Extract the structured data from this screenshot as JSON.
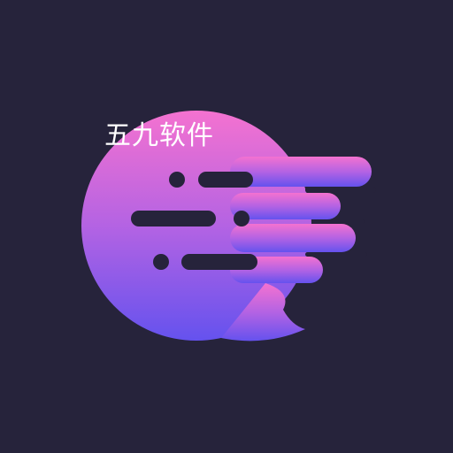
{
  "watermark": {
    "text": "五九软件"
  },
  "logo": {
    "icon": "chat-bubble-logo-icon",
    "gradient_top": "#f06fd3",
    "gradient_mid": "#b463e3",
    "gradient_bottom": "#6a54ec",
    "background": "#26233b",
    "line_color": "#26233b"
  }
}
